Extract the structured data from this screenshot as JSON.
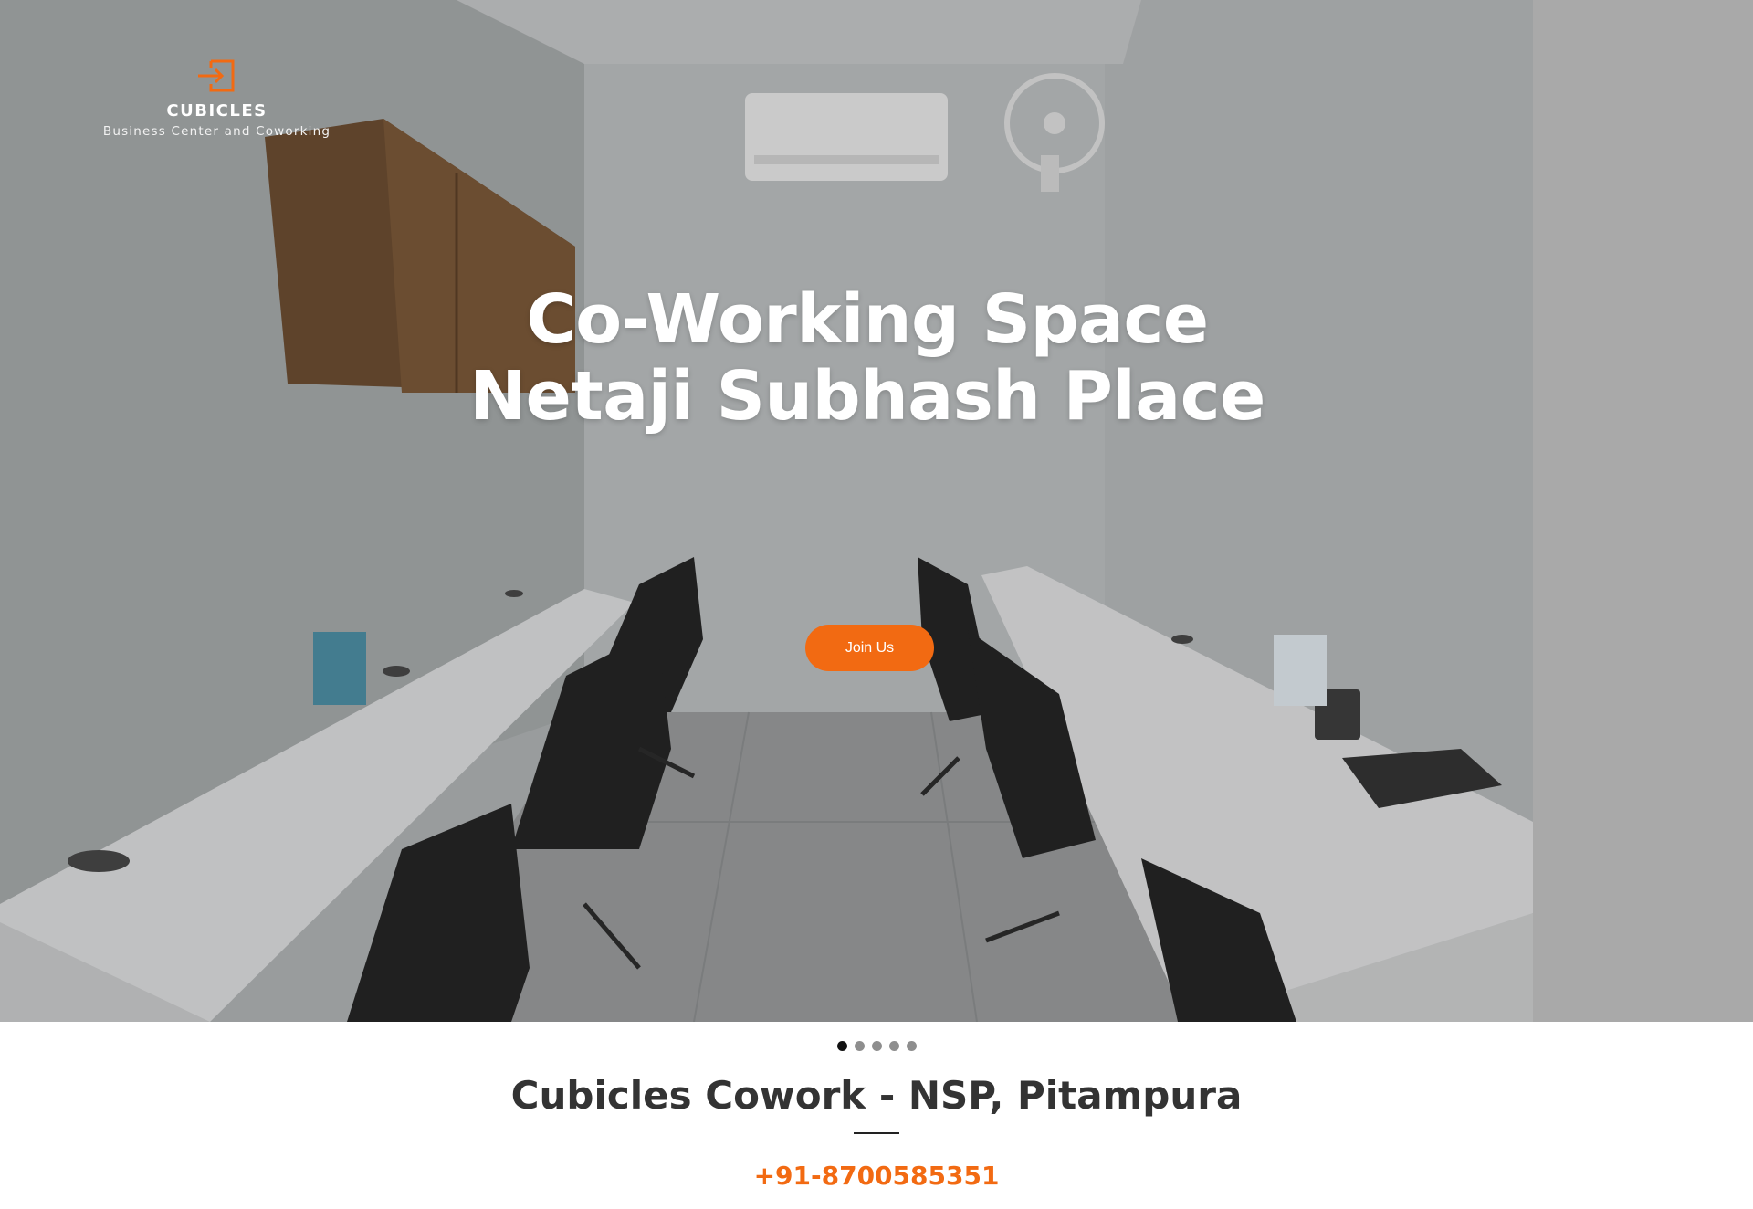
{
  "colors": {
    "accent": "#f26a12",
    "heading_dark": "#333333",
    "hero_text": "#ffffff"
  },
  "logo": {
    "icon": "login-arrow-icon",
    "title": "CUBICLES",
    "subtitle": "Business Center and Coworking"
  },
  "hero": {
    "headline_line1": "Co-Working Space",
    "headline_line2": "Netaji Subhash Place",
    "cta_label": "Join Us",
    "slides_total": 5,
    "active_slide": 1
  },
  "info": {
    "title": "Cubicles Cowork - NSP, Pitampura",
    "phone": "+91-8700585351"
  }
}
